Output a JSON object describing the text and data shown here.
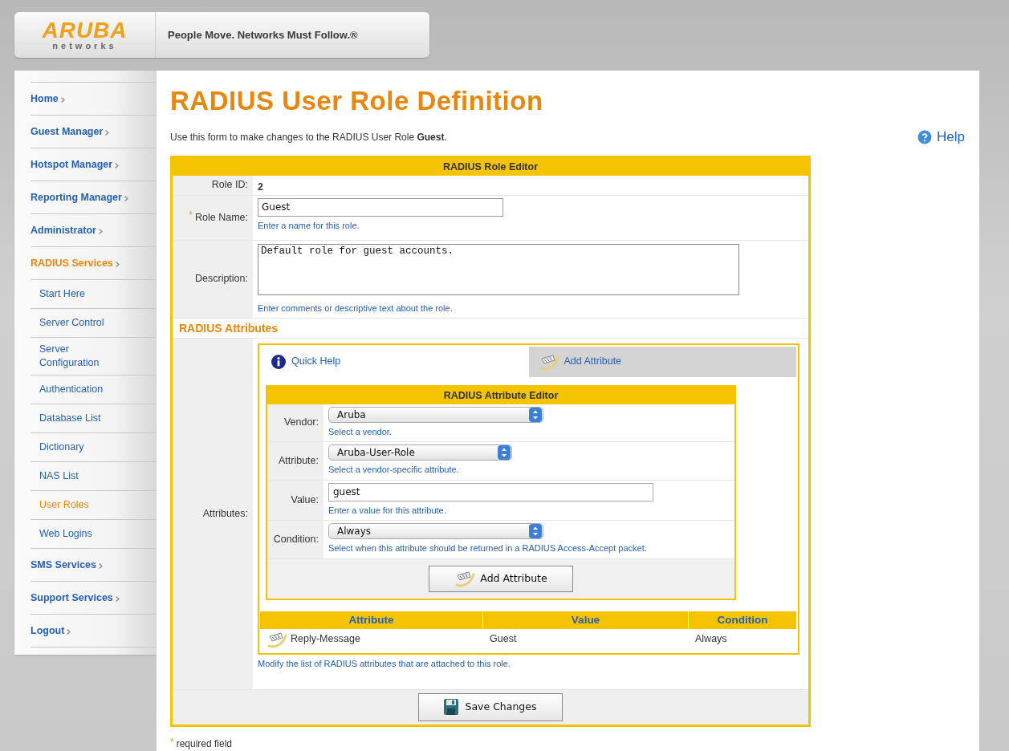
{
  "header": {
    "logo_word": "ARUBA",
    "logo_sub": "networks",
    "tagline": "People Move. Networks Must Follow.®"
  },
  "sidebar": {
    "items": [
      {
        "label": "Home",
        "kind": "section",
        "selected": false
      },
      {
        "label": "Guest Manager",
        "kind": "section",
        "selected": false
      },
      {
        "label": "Hotspot Manager",
        "kind": "section",
        "selected": false
      },
      {
        "label": "Reporting Manager",
        "kind": "section",
        "selected": false
      },
      {
        "label": "Administrator",
        "kind": "section",
        "selected": false
      },
      {
        "label": "RADIUS Services",
        "kind": "section",
        "selected": true
      },
      {
        "label": "Start Here",
        "kind": "sub",
        "selected": false
      },
      {
        "label": "Server Control",
        "kind": "sub",
        "selected": false
      },
      {
        "label": "Server Configuration",
        "kind": "sub",
        "selected": false
      },
      {
        "label": "Authentication",
        "kind": "sub",
        "selected": false
      },
      {
        "label": "Database List",
        "kind": "sub",
        "selected": false
      },
      {
        "label": "Dictionary",
        "kind": "sub",
        "selected": false
      },
      {
        "label": "NAS List",
        "kind": "sub",
        "selected": false
      },
      {
        "label": "User Roles",
        "kind": "sub",
        "selected": true
      },
      {
        "label": "Web Logins",
        "kind": "sub",
        "selected": false
      },
      {
        "label": "SMS Services",
        "kind": "section",
        "selected": false
      },
      {
        "label": "Support Services",
        "kind": "section",
        "selected": false
      },
      {
        "label": "Logout",
        "kind": "section",
        "selected": false
      }
    ]
  },
  "page": {
    "title": "RADIUS User Role Definition",
    "intro": "Use this form to make changes to the RADIUS User Role **Guest**.",
    "help": "Help"
  },
  "role_editor": {
    "title": "RADIUS Role Editor",
    "role_id": {
      "label": "Role ID:",
      "value": "2"
    },
    "role_name": {
      "label": "Role Name:",
      "marker": "*",
      "value": "Guest",
      "hint": "Enter a name for this role."
    },
    "description": {
      "label": "Description:",
      "value": "Default role for guest accounts.",
      "hint": "Enter comments or descriptive text about the role."
    },
    "section": "RADIUS Attributes",
    "attributes": {
      "label": "Attributes:",
      "tabs": [
        {
          "label": "Quick Help",
          "kind": "help",
          "selected": false
        },
        {
          "label": "Add Attribute",
          "kind": "add",
          "selected": true
        }
      ],
      "editor": {
        "title": "RADIUS Attribute Editor",
        "fields": [
          {
            "kind": "select",
            "label": "Vendor:",
            "value": "Aruba",
            "hint": "Select a vendor."
          },
          {
            "kind": "select",
            "label": "Attribute:",
            "value": "Aruba-User-Role",
            "hint": "Select a vendor-specific attribute."
          },
          {
            "kind": "text",
            "label": "Value:",
            "value": "guest",
            "hint": "Enter a value for this attribute."
          },
          {
            "kind": "select",
            "label": "Condition:",
            "value": "Always",
            "hint": "Select when this attribute should be returned in a RADIUS Access-Accept packet."
          }
        ],
        "button": "Add Attribute"
      },
      "table": {
        "columns": [
          "Attribute",
          "Value",
          "Condition"
        ],
        "rows": [
          {
            "attribute": "Reply-Message",
            "value": "Guest",
            "condition": "Always"
          }
        ]
      },
      "hint": "Modify the list of RADIUS attributes that are attached to this role."
    },
    "save_button": "Save Changes"
  },
  "footnote": {
    "marker": "*",
    "text": "required field"
  }
}
